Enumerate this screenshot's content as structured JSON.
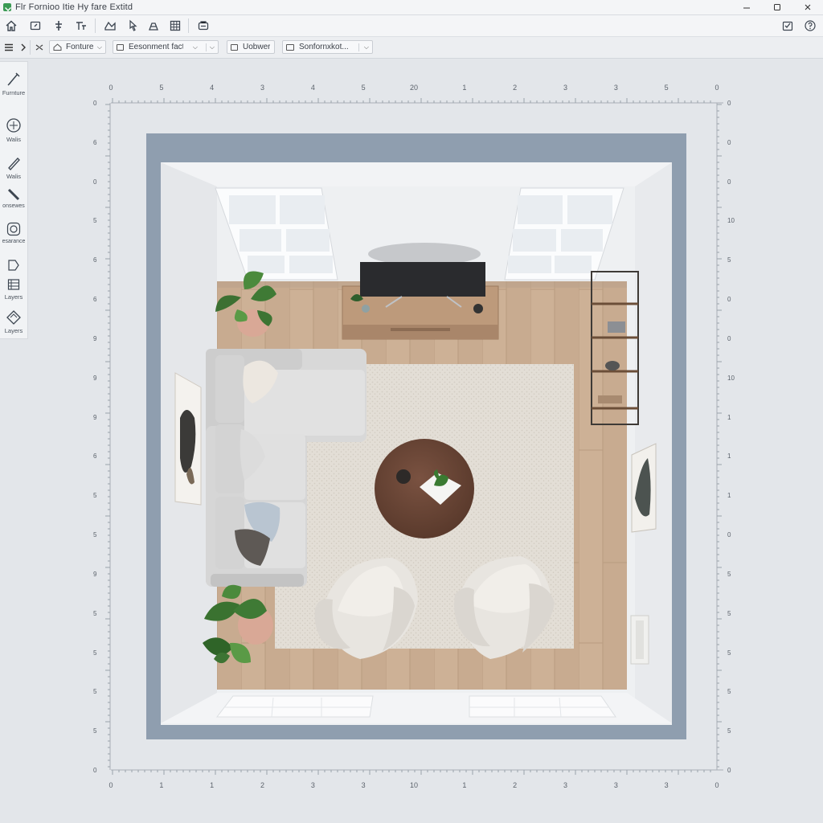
{
  "window": {
    "title": "Flr Fornioo Itie Hy fare Extitd",
    "accent": "#3a9a54",
    "controls": [
      "minimize",
      "maximize",
      "close"
    ]
  },
  "toolbar": {
    "icons": [
      "home-icon",
      "export-icon",
      "select-icon",
      "measure-icon",
      "shapes-icon",
      "pointer-icon",
      "object-icon",
      "grid-icon",
      "render-icon",
      "checklist-icon",
      "help-icon"
    ]
  },
  "toolbar2": {
    "furniture_select": "Fonture",
    "element_select": "Eesonment fact...",
    "view_button": "Uobwer",
    "settings_select": "Sonfornxkot..."
  },
  "left_panel": {
    "items": [
      {
        "label": "Furnture",
        "icon": "brush-icon"
      },
      {
        "label": "Walis",
        "icon": "compass-icon"
      },
      {
        "label": "Walis",
        "icon": "pencil-icon"
      },
      {
        "label": "onsewes",
        "icon": "ruler-icon"
      },
      {
        "label": "esarance",
        "icon": "target-icon"
      },
      {
        "label": "",
        "icon": "cursor-icon"
      },
      {
        "label": "Layers",
        "icon": "layers-list-icon"
      },
      {
        "label": "Layers",
        "icon": "layers-diamond-icon"
      }
    ]
  },
  "rulers": {
    "top": [
      "0",
      "5",
      "4",
      "3",
      "4",
      "5",
      "20",
      "1",
      "2",
      "3",
      "3",
      "5",
      "0"
    ],
    "bottom": [
      "0",
      "1",
      "1",
      "2",
      "3",
      "3",
      "10",
      "1",
      "2",
      "3",
      "3",
      "3",
      "0"
    ],
    "left": [
      "0",
      "6",
      "0",
      "5",
      "6",
      "6",
      "9",
      "9",
      "9",
      "6",
      "5",
      "5",
      "9",
      "5",
      "5",
      "5",
      "5",
      "0"
    ],
    "right": [
      "0",
      "0",
      "0",
      "10",
      "5",
      "0",
      "0",
      "10",
      "1",
      "1",
      "1",
      "0",
      "5",
      "5",
      "5",
      "5",
      "5",
      "0"
    ]
  },
  "colors": {
    "wall": "#8f9eaf",
    "floor": "#c9ad92",
    "rug": "#e2ddd5",
    "sofa": "#dcdcdc",
    "table": "#6b4636"
  }
}
